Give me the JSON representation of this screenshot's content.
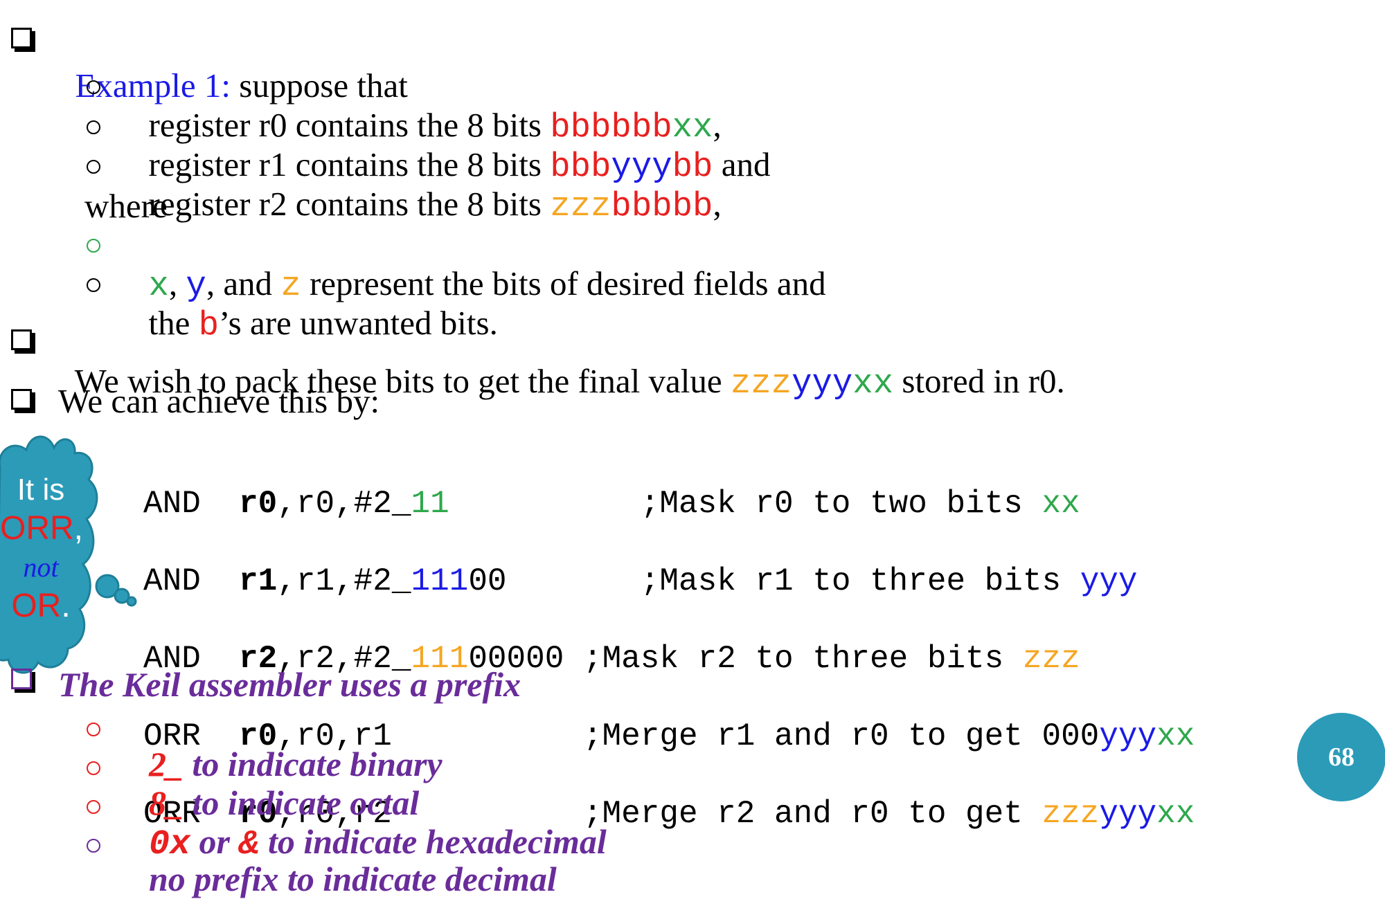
{
  "slide": {
    "ex1": {
      "label": "Example 1:",
      "rest": " suppose that"
    },
    "r0": {
      "pre": "register r0 contains the 8 bits ",
      "bits_b": "bbbbbb",
      "bits_x": "xx",
      "post": ","
    },
    "r1": {
      "pre": "register r1 contains the 8 bits ",
      "bits_b1": "bbb",
      "bits_y": "yyy",
      "bits_b2": "bb",
      "post": " and"
    },
    "r2": {
      "pre": "register r2 contains the 8 bits ",
      "bits_z": "zzz",
      "bits_b": "bbbbb",
      "post": ","
    },
    "where": "where",
    "fields": {
      "x": "x",
      "c1": ", ",
      "y": "y",
      "c2": ", and ",
      "z": "z",
      "post": " represent the bits of desired fields and"
    },
    "unwanted": {
      "pre": "the ",
      "b": "b",
      "post": "’s are unwanted bits."
    },
    "pack": {
      "pre": "We wish to pack these bits to get the final value ",
      "z": "zzz",
      "y": "yyy",
      "x": "xx",
      "post": " stored in r0."
    },
    "achieve": "We can achieve this by:"
  },
  "code": [
    {
      "op": "AND",
      "dst": "r0",
      "args": ",r0,#2_",
      "c1": "11",
      "c2": "",
      "comment": ";Mask r0 to two bits ",
      "cc": "xx"
    },
    {
      "op": "AND",
      "dst": "r1",
      "args": ",r1,#2_",
      "c1": "111",
      "c2": "00",
      "comment": ";Mask r1 to three bits ",
      "cc": "yyy"
    },
    {
      "op": "AND",
      "dst": "r2",
      "args": ",r2,#2_",
      "c1": "111",
      "c2": "00000",
      "comment": ";Mask r2 to three bits ",
      "cc": "zzz"
    },
    {
      "op": "ORR",
      "dst": "r0",
      "args": ",r0,r1",
      "comment": ";Merge r1 and r0 to get ",
      "c0": "000",
      "cy": "yyy",
      "cx": "xx"
    },
    {
      "op": "ORR",
      "dst": "r0",
      "args": ",r0,r2",
      "comment": ";Merge r2 and r0 to get ",
      "cz": "zzz",
      "cy": "yyy",
      "cx": "xx"
    }
  ],
  "cloud": {
    "l1": "It is",
    "l2": "ORR",
    "l2b": ",",
    "l3": "not",
    "l4": "OR",
    "l4b": "."
  },
  "keil": {
    "title": "The Keil assembler uses a prefix",
    "items": [
      {
        "pre": "2_",
        "post": " to indicate binary"
      },
      {
        "pre": "8_",
        "post": " to indicate octal"
      },
      {
        "pre1": "0x",
        "mid": " or ",
        "pre2": "&",
        "post": " to indicate hexadecimal"
      },
      {
        "post": "no prefix to indicate decimal"
      }
    ]
  },
  "page_number": "68",
  "colors": {
    "accent_teal": "#2b9bb8",
    "red": "#e8201f",
    "green": "#2ea84c",
    "blue": "#1a1ae6",
    "orange": "#f5a623",
    "purple": "#6a2c9a"
  }
}
